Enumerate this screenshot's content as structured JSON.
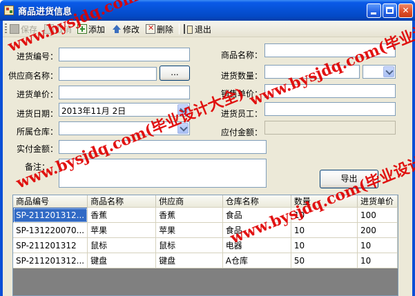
{
  "window": {
    "title": "商品进货信息"
  },
  "toolbar": {
    "save": "保存",
    "cancel": "取消",
    "add": "添加",
    "edit": "修改",
    "delete": "删除",
    "exit": "退出"
  },
  "form": {
    "purchase_no_label": "进货编号：",
    "purchase_no_value": "",
    "product_name_label": "商品名称：",
    "product_name_value": "",
    "supplier_label": "供应商名称：",
    "supplier_value": "",
    "browse_button": "...",
    "quantity_label": "进货数量：",
    "quantity_value": "",
    "unit_value": "",
    "purchase_price_label": "进货单价：",
    "purchase_price_value": "",
    "sale_price_label": "销售单价：",
    "sale_price_value": "",
    "date_label": "进货日期：",
    "date_value": "2013年11月  2日",
    "staff_label": "进货员工：",
    "staff_value": "",
    "warehouse_label": "所属仓库：",
    "warehouse_value": "",
    "payable_label": "应付金额：",
    "payable_value": "",
    "paid_label": "实付金额：",
    "paid_value": "",
    "remark_label": "备注：",
    "remark_value": "",
    "export_button": "导出"
  },
  "grid": {
    "columns": [
      "商品编号",
      "商品名称",
      "供应商",
      "仓库名称",
      "数量",
      "进货单价"
    ],
    "rows": [
      [
        "SP-211201312...",
        "香蕉",
        "香蕉",
        "食品",
        "10",
        "100"
      ],
      [
        "SP-131220070...",
        "苹果",
        "苹果",
        "食品",
        "10",
        "200"
      ],
      [
        "SP-211201312",
        "鼠标",
        "鼠标",
        "电器",
        "10",
        "10"
      ],
      [
        "SP-211201312...",
        "键盘",
        "键盘",
        "A仓库",
        "50",
        "10"
      ]
    ]
  },
  "watermark": {
    "text": "www.bysjdq.com(毕业设计大全)"
  }
}
